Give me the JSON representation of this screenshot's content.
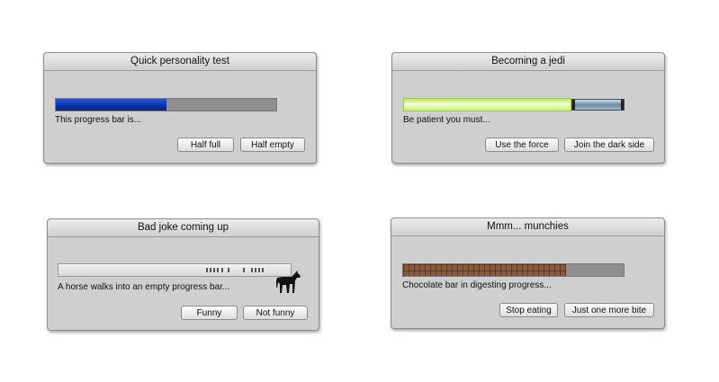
{
  "dialogs": [
    {
      "title": "Quick personality test",
      "message": "This progress bar is...",
      "progress_fraction": 0.5,
      "buttons": [
        "Half full",
        "Half empty"
      ]
    },
    {
      "title": "Becoming a jedi",
      "message": "Be patient you must...",
      "buttons": [
        "Use the force",
        "Join the dark side"
      ]
    },
    {
      "title": "Bad joke coming up",
      "message": "A horse walks into an empty progress bar...",
      "buttons": [
        "Funny",
        "Not funny"
      ]
    },
    {
      "title": "Mmm... munchies",
      "message": "Chocolate bar in digesting progress...",
      "progress_fraction": 0.74,
      "buttons": [
        "Stop eating",
        "Just one more bite"
      ]
    }
  ],
  "colors": {
    "blue_fill": "#0b2fa6",
    "saber_blade": "#d6f49a",
    "chocolate": "#8b5a3c"
  },
  "icons": [
    "horse-icon"
  ]
}
